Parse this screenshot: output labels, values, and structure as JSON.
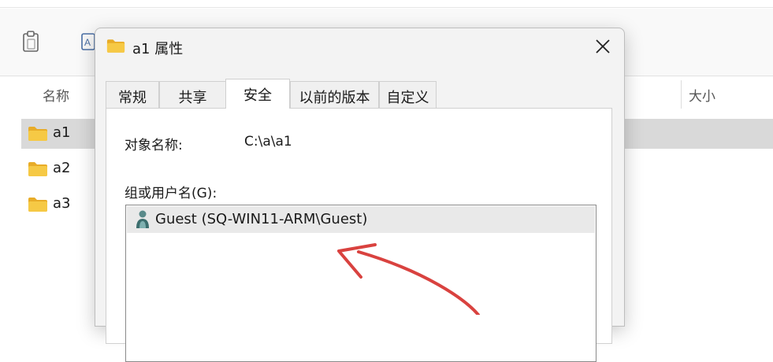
{
  "explorer": {
    "columns": {
      "name": "名称",
      "size": "大小"
    },
    "items": [
      {
        "label": "a1",
        "selected": true
      },
      {
        "label": "a2",
        "selected": false
      },
      {
        "label": "a3",
        "selected": false
      }
    ],
    "toolbar_icons": [
      "clipboard-icon",
      "rename-icon"
    ]
  },
  "dialog": {
    "title": "a1 属性",
    "tabs": [
      {
        "label": "常规",
        "active": false
      },
      {
        "label": "共享",
        "active": false
      },
      {
        "label": "安全",
        "active": true
      },
      {
        "label": "以前的版本",
        "active": false
      },
      {
        "label": "自定义",
        "active": false
      }
    ],
    "object_name_label": "对象名称:",
    "object_name_value": "C:\\a\\a1",
    "group_label": "组或用户名(G):",
    "users": [
      {
        "name": "Guest (SQ-WIN11-ARM\\Guest)",
        "icon": "user-icon"
      }
    ]
  },
  "colors": {
    "folder": "#f2c037",
    "selection": "#d9d9d9",
    "annotation_arrow": "#d9423f"
  }
}
